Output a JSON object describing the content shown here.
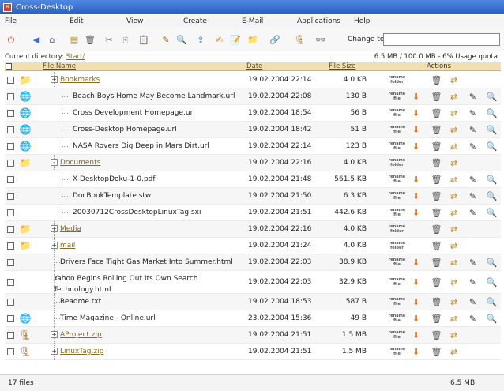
{
  "window": {
    "title": "Cross-Desktop"
  },
  "menu": [
    "File",
    "Edit",
    "View",
    "Create",
    "E-Mail",
    "Applications",
    "Help"
  ],
  "toolbar": {
    "icons": [
      {
        "name": "power-icon",
        "glyph": "⏻",
        "color": "#e0501f"
      },
      {
        "name": "back-icon",
        "glyph": "◀",
        "color": "#3b6fc6"
      },
      {
        "name": "home-icon",
        "glyph": "⌂",
        "color": "#3b6fc6"
      },
      {
        "name": "document-icon",
        "glyph": "▤",
        "color": "#c08a20"
      },
      {
        "name": "trash-icon",
        "glyph": "🗑",
        "color": "#555555"
      },
      {
        "name": "cut-icon",
        "glyph": "✂",
        "color": "#666666"
      },
      {
        "name": "copy-icon",
        "glyph": "⎘",
        "color": "#777777"
      },
      {
        "name": "paste-icon",
        "glyph": "📋",
        "color": "#c08a20"
      },
      {
        "name": "edit-icon",
        "glyph": "✎",
        "color": "#8a6a20"
      },
      {
        "name": "preview-icon",
        "glyph": "🔍",
        "color": "#666666"
      },
      {
        "name": "upload-icon",
        "glyph": "⇪",
        "color": "#3b6fc6"
      },
      {
        "name": "new-file-icon",
        "glyph": "✍",
        "color": "#c08a20"
      },
      {
        "name": "new-note-icon",
        "glyph": "📝",
        "color": "#c08a20"
      },
      {
        "name": "new-folder-icon",
        "glyph": "📁",
        "color": "#e0b020"
      },
      {
        "name": "new-link-icon",
        "glyph": "🔗",
        "color": "#3b6fc6"
      },
      {
        "name": "archive-icon",
        "glyph": "🗜",
        "color": "#b0701f"
      },
      {
        "name": "search-icon",
        "glyph": "👓",
        "color": "#333333"
      }
    ],
    "change_to_label": "Change to",
    "change_to_value": ""
  },
  "directory": {
    "label": "Current directory:",
    "path": "Start/",
    "quota": "6.5 MB / 100.0 MB - 6% Usage quota"
  },
  "columns": {
    "name": "File Name",
    "date": "Date",
    "size": "File Size",
    "actions": "Actions"
  },
  "rename_label_top": "rename",
  "rename_label_bottom": "file",
  "rename_folder_bottom": "folder",
  "files": [
    {
      "name": "Bookmarks",
      "date": "19.02.2004 22:14",
      "size": "4.0 KB",
      "kind": "folder",
      "icon": "folder-icon",
      "glyph": "📁",
      "expander": "+",
      "depth": 0,
      "actions": "folder"
    },
    {
      "name": "Beach Boys Home May Become Landmark.url",
      "date": "19.02.2004 22:08",
      "size": "130 B",
      "kind": "file",
      "icon": "url-icon",
      "glyph": "🌐",
      "depth": 1,
      "actions": "file"
    },
    {
      "name": "Cross Development Homepage.url",
      "date": "19.02.2004 18:54",
      "size": "56 B",
      "kind": "file",
      "icon": "url-icon",
      "glyph": "🌐",
      "depth": 1,
      "actions": "file"
    },
    {
      "name": "Cross-Desktop Homepage.url",
      "date": "19.02.2004 18:42",
      "size": "51 B",
      "kind": "file",
      "icon": "url-icon",
      "glyph": "🌐",
      "depth": 1,
      "actions": "file"
    },
    {
      "name": "NASA Rovers Dig Deep in Mars Dirt.url",
      "date": "19.02.2004 22:14",
      "size": "123 B",
      "kind": "file",
      "icon": "url-icon",
      "glyph": "🌐",
      "depth": 1,
      "actions": "file"
    },
    {
      "name": "Documents",
      "date": "19.02.2004 22:16",
      "size": "4.0 KB",
      "kind": "folder",
      "icon": "folder-icon",
      "glyph": "📁",
      "expander": "-",
      "depth": 0,
      "actions": "folder"
    },
    {
      "name": "X-DesktopDoku-1-0.pdf",
      "date": "19.02.2004 21:48",
      "size": "561.5 KB",
      "kind": "file",
      "icon": "",
      "glyph": "",
      "depth": 1,
      "actions": "file"
    },
    {
      "name": "DocBookTemplate.stw",
      "date": "19.02.2004 21:50",
      "size": "6.3 KB",
      "kind": "file",
      "icon": "",
      "glyph": "",
      "depth": 1,
      "actions": "file"
    },
    {
      "name": "20030712CrossDesktopLinuxTag.sxi",
      "date": "19.02.2004 21:51",
      "size": "442.6 KB",
      "kind": "file",
      "icon": "",
      "glyph": "",
      "depth": 1,
      "actions": "file"
    },
    {
      "name": "Media",
      "date": "19.02.2004 22:16",
      "size": "4.0 KB",
      "kind": "folder",
      "icon": "folder-icon",
      "glyph": "📁",
      "expander": "+",
      "depth": 0,
      "actions": "folder"
    },
    {
      "name": "mail",
      "date": "19.02.2004 21:24",
      "size": "4.0 KB",
      "kind": "folder",
      "icon": "folder-icon",
      "glyph": "📁",
      "expander": "+",
      "depth": 0,
      "actions": "folder"
    },
    {
      "name": "Drivers Face Tight Gas Market Into Summer.html",
      "date": "19.02.2004 22:03",
      "size": "38.9 KB",
      "kind": "file",
      "icon": "",
      "glyph": "",
      "depth": 0,
      "actions": "file"
    },
    {
      "name": "Yahoo Begins Rolling Out Its Own Search Technology.html",
      "date": "19.02.2004 22:03",
      "size": "32.9 KB",
      "kind": "file",
      "icon": "",
      "glyph": "",
      "depth": 0,
      "actions": "file",
      "tall": true
    },
    {
      "name": "Readme.txt",
      "date": "19.02.2004 18:53",
      "size": "587 B",
      "kind": "file",
      "icon": "",
      "glyph": "",
      "depth": 0,
      "actions": "file"
    },
    {
      "name": "Time Magazine - Online.url",
      "date": "23.02.2004 15:36",
      "size": "49 B",
      "kind": "file",
      "icon": "url-icon",
      "glyph": "🌐",
      "depth": 0,
      "actions": "file"
    },
    {
      "name": "AProject.zip",
      "date": "19.02.2004 21:51",
      "size": "1.5 MB",
      "kind": "archive",
      "icon": "zip-icon",
      "glyph": "🗜",
      "expander": "+",
      "depth": 0,
      "actions": "archive"
    },
    {
      "name": "LinuxTag.zip",
      "date": "19.02.2004 21:51",
      "size": "1.5 MB",
      "kind": "archive",
      "icon": "zip-icon",
      "glyph": "🗜",
      "expander": "+",
      "depth": 0,
      "actions": "archive"
    }
  ],
  "status": {
    "count": "17 files",
    "total": "6.5 MB"
  },
  "colors": {
    "title_bar": "#2a5fc4",
    "header": "#f2dfb0",
    "folder_link": "#8a6a20"
  }
}
